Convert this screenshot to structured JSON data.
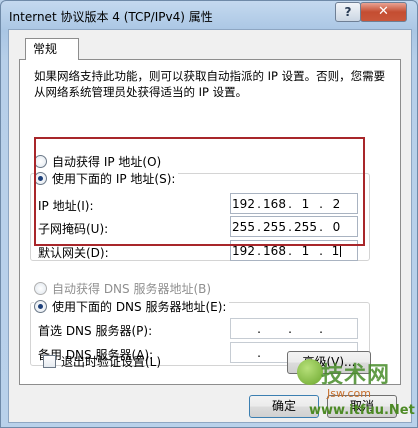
{
  "window": {
    "title": "Internet 协议版本 4 (TCP/IPv4) 属性",
    "help_label": "?",
    "close_label": "✕"
  },
  "tabs": [
    {
      "label": "常规"
    }
  ],
  "description": "如果网络支持此功能，则可以获取自动指派的 IP 设置。否则，您需要从网络系统管理员处获得适当的 IP 设置。",
  "ip_section": {
    "auto_label": "自动获得 IP 地址(O)",
    "manual_label": "使用下面的 IP 地址(S):",
    "selected": "manual",
    "fields": [
      {
        "label": "IP 地址(I):",
        "octets": [
          "192",
          "168",
          "1",
          "2"
        ]
      },
      {
        "label": "子网掩码(U):",
        "octets": [
          "255",
          "255",
          "255",
          "0"
        ]
      },
      {
        "label": "默认网关(D):",
        "octets": [
          "192",
          "168",
          "1",
          "1"
        ]
      }
    ]
  },
  "dns_section": {
    "auto_label": "自动获得 DNS 服务器地址(B)",
    "manual_label": "使用下面的 DNS 服务器地址(E):",
    "selected": "manual",
    "fields": [
      {
        "label": "首选 DNS 服务器(P):",
        "octets": [
          "",
          "",
          "",
          ""
        ]
      },
      {
        "label": "备用 DNS 服务器(A):",
        "octets": [
          "",
          "",
          "",
          ""
        ]
      }
    ]
  },
  "validate_on_exit": {
    "label": "退出时验证设置(L)",
    "checked": false
  },
  "buttons": {
    "advanced": "高级(V)...",
    "ok": "确定",
    "cancel": "取消"
  },
  "watermark": {
    "brand": "技术网",
    "line1": "Jsw.com",
    "line2": "www.itfuu.Net"
  },
  "colors": {
    "highlight_box": "#a8262a",
    "close_button": "#c44d31"
  }
}
